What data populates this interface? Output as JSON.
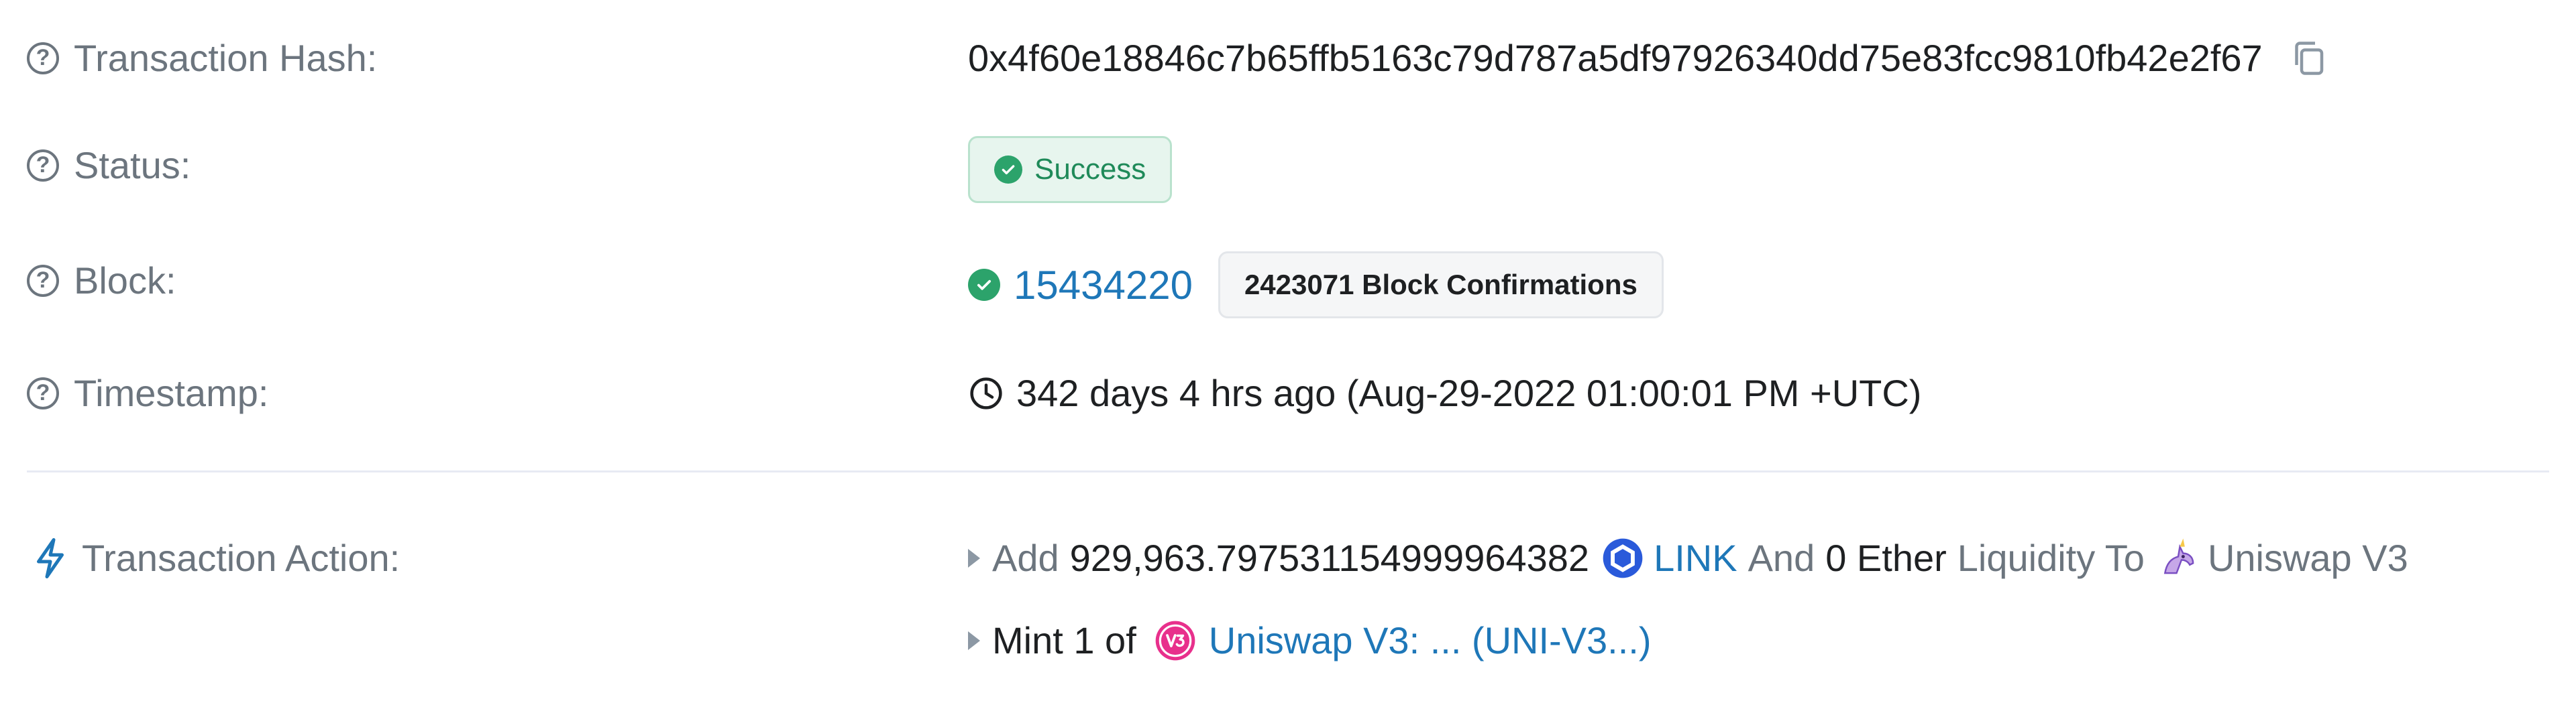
{
  "transaction_hash": {
    "label": "Transaction Hash:",
    "value": "0x4f60e18846c7b65ffb5163c79d787a5df97926340dd75e83fcc9810fb42e2f67"
  },
  "status": {
    "label": "Status:",
    "value": "Success"
  },
  "block": {
    "label": "Block:",
    "number": "15434220",
    "confirmations": "2423071 Block Confirmations"
  },
  "timestamp": {
    "label": "Timestamp:",
    "value": "342 days 4 hrs ago (Aug-29-2022 01:00:01 PM +UTC)"
  },
  "transaction_action": {
    "label": "Transaction Action:",
    "line1": {
      "verb": "Add",
      "amount": "929,963.797531154999964382",
      "token": "LINK",
      "conj": "And",
      "amount2": "0 Ether",
      "phrase": "Liquidity To",
      "dex": "Uniswap V3"
    },
    "line2": {
      "verb": "Mint 1 of",
      "nft": "Uniswap V3: ... (UNI-V3...)"
    }
  },
  "colors": {
    "accent_link": "#1e77b8",
    "success": "#2ca36b"
  }
}
